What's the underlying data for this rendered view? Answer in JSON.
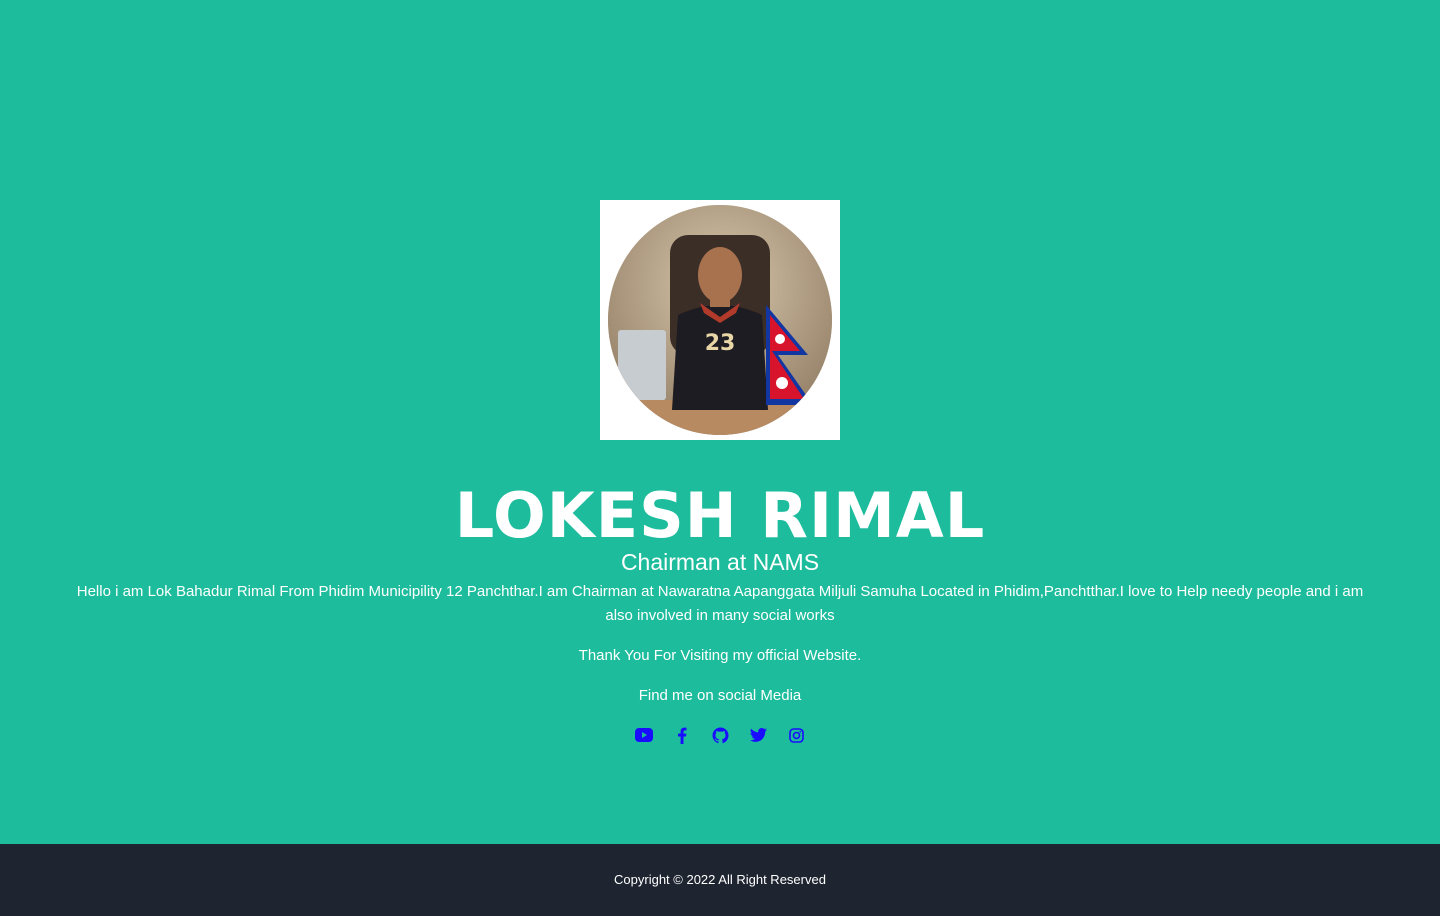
{
  "profile": {
    "name": "LOKESH RIMAL",
    "title": "Chairman at NAMS",
    "bio": "Hello i am Lok Bahadur Rimal From Phidim Municipility 12 Panchthar.I am Chairman at Nawaratna Aapanggata Miljuli Samuha Located in Phidim,Panchtthar.I love to Help needy people and i am also involved in many social works",
    "thanks": "Thank You For Visiting my official Website.",
    "find_me": "Find me on social Media"
  },
  "socials": [
    {
      "icon": "youtube-icon"
    },
    {
      "icon": "facebook-icon"
    },
    {
      "icon": "github-icon"
    },
    {
      "icon": "twitter-icon"
    },
    {
      "icon": "instagram-icon"
    }
  ],
  "footer": {
    "copyright": "Copyright © 2022 All Right Reserved"
  },
  "colors": {
    "background": "#1cbc9c",
    "footer": "#1e2530",
    "text": "#ffffff",
    "social_icons": "#1a0dff"
  }
}
